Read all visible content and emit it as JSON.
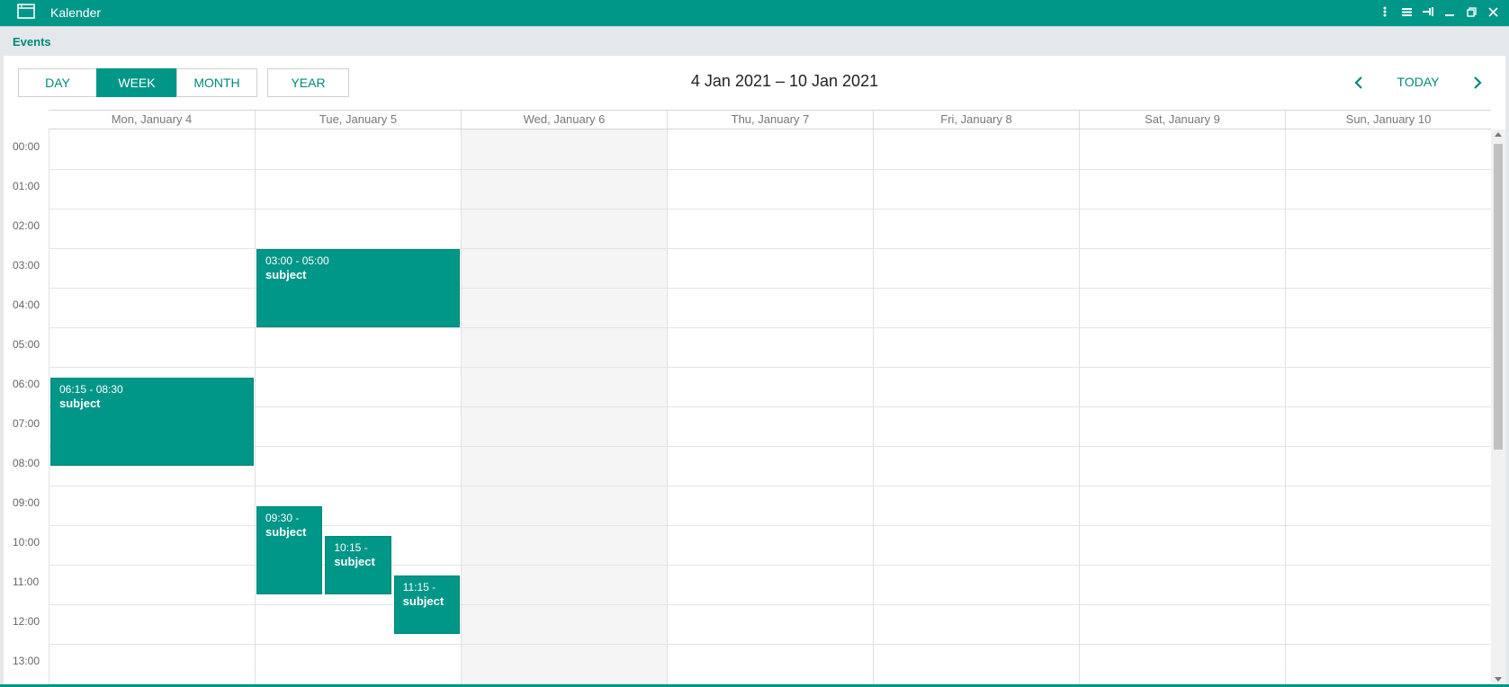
{
  "window": {
    "title": "Kalender",
    "icon": "calendar-window-icon"
  },
  "panel": {
    "title": "Events"
  },
  "toolbar": {
    "views": [
      "DAY",
      "WEEK",
      "MONTH",
      "YEAR"
    ],
    "active_view": "WEEK",
    "date_range": "4 Jan 2021 – 10 Jan 2021",
    "today_label": "TODAY"
  },
  "days": [
    "Mon, January 4",
    "Tue, January 5",
    "Wed, January 6",
    "Thu, January 7",
    "Fri, January 8",
    "Sat, January 9",
    "Sun, January 10"
  ],
  "highlighted_day": "Wed, January 6",
  "hours": [
    "00:00",
    "01:00",
    "02:00",
    "03:00",
    "04:00",
    "05:00",
    "06:00",
    "07:00",
    "08:00",
    "09:00",
    "10:00",
    "11:00",
    "12:00",
    "13:00"
  ],
  "events": [
    {
      "day": 1,
      "start": 3.0,
      "end": 5.0,
      "time_label": "03:00 - 05:00",
      "subject": "subject",
      "lane": 0,
      "lanes": 1
    },
    {
      "day": 0,
      "start": 6.25,
      "end": 8.5,
      "time_label": "06:15 - 08:30",
      "subject": "subject",
      "lane": 0,
      "lanes": 1
    },
    {
      "day": 1,
      "start": 9.5,
      "end": 11.75,
      "time_label": "09:30 -",
      "subject": "subject",
      "lane": 0,
      "lanes": 3
    },
    {
      "day": 1,
      "start": 10.25,
      "end": 11.75,
      "time_label": "10:15 -",
      "subject": "subject",
      "lane": 1,
      "lanes": 3
    },
    {
      "day": 1,
      "start": 11.25,
      "end": 12.75,
      "time_label": "11:15 -",
      "subject": "subject",
      "lane": 2,
      "lanes": 3
    }
  ],
  "colors": {
    "accent": "#009688",
    "event_bg": "#009688",
    "highlight_column": "#f5f5f5"
  }
}
